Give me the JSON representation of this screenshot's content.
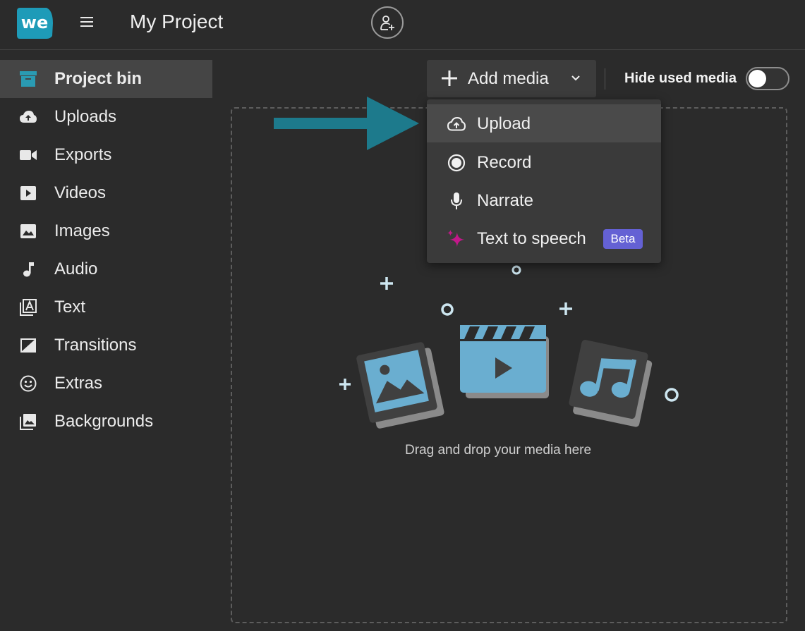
{
  "header": {
    "logo_text": "we",
    "project_title": "My Project"
  },
  "sidebar": {
    "items": [
      {
        "label": "Project bin",
        "icon": "archive-icon",
        "active": true
      },
      {
        "label": "Uploads",
        "icon": "cloud-upload-icon"
      },
      {
        "label": "Exports",
        "icon": "video-camera-icon"
      },
      {
        "label": "Videos",
        "icon": "play-box-icon"
      },
      {
        "label": "Images",
        "icon": "image-icon"
      },
      {
        "label": "Audio",
        "icon": "music-note-icon"
      },
      {
        "label": "Text",
        "icon": "text-box-icon"
      },
      {
        "label": "Transitions",
        "icon": "transition-icon"
      },
      {
        "label": "Extras",
        "icon": "smiley-icon"
      },
      {
        "label": "Backgrounds",
        "icon": "backgrounds-icon"
      }
    ]
  },
  "toolbar": {
    "add_media_label": "Add media",
    "hide_used_label": "Hide used media",
    "hide_used_on": false
  },
  "dropdown": {
    "items": [
      {
        "label": "Upload",
        "icon": "cloud-upload-icon",
        "hover": true
      },
      {
        "label": "Record",
        "icon": "record-icon"
      },
      {
        "label": "Narrate",
        "icon": "microphone-icon"
      },
      {
        "label": "Text to speech",
        "icon": "sparkle-icon",
        "badge": "Beta"
      }
    ]
  },
  "dropzone": {
    "text": "Drag and drop your media here"
  },
  "colors": {
    "background": "#2b2b2b",
    "accent_teal": "#1d7a8c",
    "illustration_blue": "#6aaed0",
    "beta_badge": "#6461d4",
    "sparkle": "#c2188a"
  }
}
